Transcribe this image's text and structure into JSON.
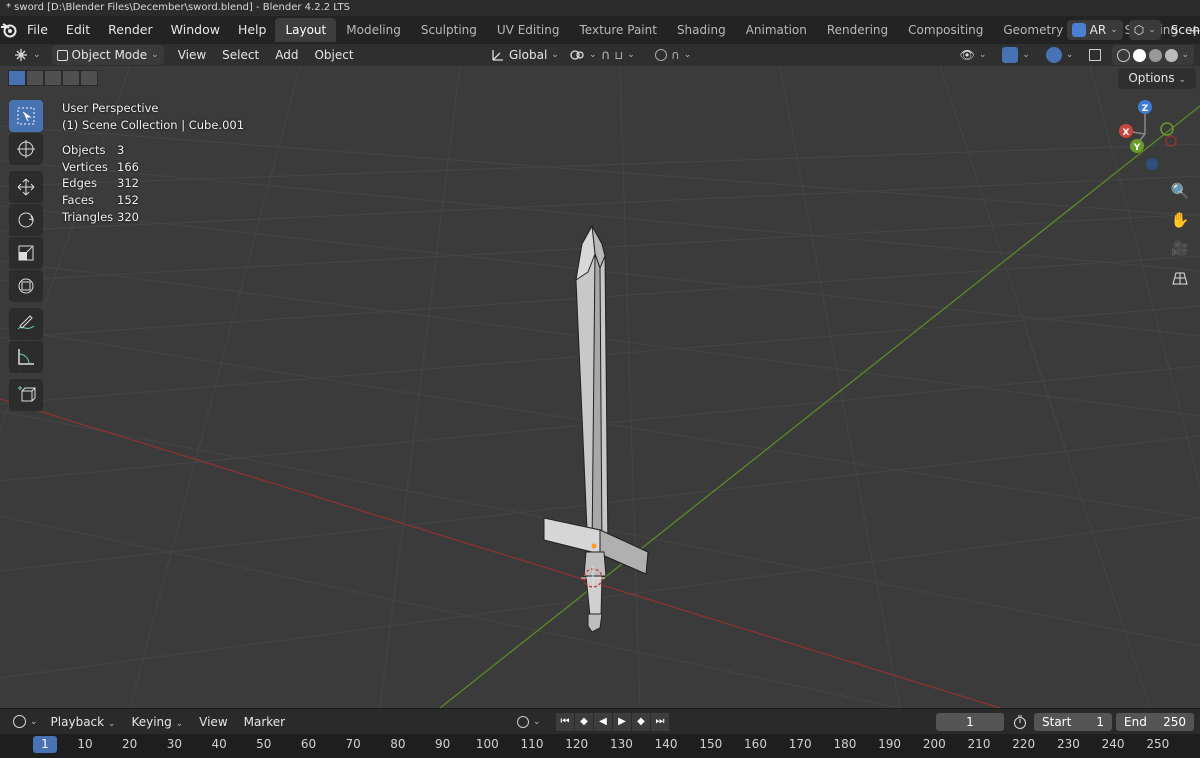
{
  "window": {
    "title": "* sword [D:\\Blender Files\\December\\sword.blend] - Blender 4.2.2 LTS"
  },
  "menu": [
    "File",
    "Edit",
    "Render",
    "Window",
    "Help"
  ],
  "workspaces": {
    "active": "Layout",
    "tabs": [
      "Layout",
      "Modeling",
      "Sculpting",
      "UV Editing",
      "Texture Paint",
      "Shading",
      "Animation",
      "Rendering",
      "Compositing",
      "Geometry Nodes",
      "Scripting"
    ]
  },
  "topright": {
    "ar_label": "AR",
    "scene_label": "Scen"
  },
  "viewport_header": {
    "mode": "Object Mode",
    "menus": [
      "View",
      "Select",
      "Add",
      "Object"
    ],
    "orientation": "Global",
    "options_label": "Options"
  },
  "overlay": {
    "perspective": "User Perspective",
    "collection": "(1) Scene Collection | Cube.001",
    "stats": [
      {
        "label": "Objects",
        "value": "3"
      },
      {
        "label": "Vertices",
        "value": "166"
      },
      {
        "label": "Edges",
        "value": "312"
      },
      {
        "label": "Faces",
        "value": "152"
      },
      {
        "label": "Triangles",
        "value": "320"
      }
    ]
  },
  "gizmo": {
    "z": "Z",
    "y": "Y",
    "x": "X"
  },
  "timeline": {
    "menus": [
      "Playback",
      "Keying",
      "View",
      "Marker"
    ],
    "current_frame": "1",
    "start_label": "Start",
    "start_value": "1",
    "end_label": "End",
    "end_value": "250"
  },
  "ruler": {
    "current": "1",
    "ticks": [
      "10",
      "20",
      "30",
      "40",
      "50",
      "60",
      "70",
      "80",
      "90",
      "100",
      "110",
      "120",
      "130",
      "140",
      "150",
      "160",
      "170",
      "180",
      "190",
      "200",
      "210",
      "220",
      "230",
      "240",
      "250"
    ]
  },
  "colors": {
    "accent": "#4772b3",
    "x_axis": "#c7463f",
    "y_axis": "#6a9a2a",
    "z_axis": "#3d7bd4"
  }
}
